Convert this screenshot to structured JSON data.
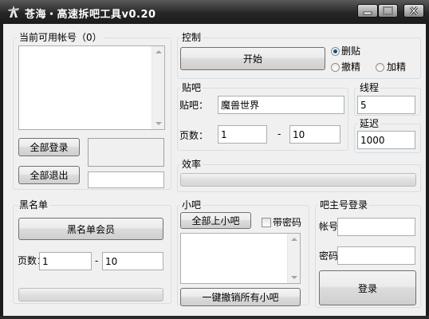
{
  "window": {
    "title": "苍海・高速拆吧工具v0.20",
    "controls": {
      "minimize": "minimize-icon",
      "maximize": "maximize-icon",
      "close": "close-icon"
    }
  },
  "accounts": {
    "group_label": "当前可用帐号（0）",
    "login_all_label": "全部登录",
    "logout_all_label": "全部退出"
  },
  "control": {
    "group_label": "控制",
    "start_label": "开始",
    "mode_delete_post": "删贴",
    "mode_remove_featured": "撤精",
    "mode_add_featured": "加精",
    "selected_mode": "删贴"
  },
  "tieba": {
    "group_label": "贴吧",
    "name_label": "贴吧：",
    "name_value": "魔兽世界",
    "pages_label": "页数：",
    "page_from": "1",
    "page_sep": "-",
    "page_to": "10"
  },
  "threads": {
    "group_label": "线程",
    "value": "5"
  },
  "delay": {
    "group_label": "延迟",
    "value": "1000"
  },
  "efficiency": {
    "group_label": "效率"
  },
  "blacklist": {
    "group_label": "黑名单",
    "members_label": "黑名单会员",
    "pages_label": "页数：",
    "page_from": "1",
    "page_sep": "-",
    "page_to": "10"
  },
  "small_bars": {
    "group_label": "小吧",
    "all_promote_label": "全部上小吧",
    "with_password_label": "带密码",
    "revoke_all_label": "一键撤销所有小吧"
  },
  "owner_login": {
    "group_label": "吧主号登录",
    "account_label": "帐号",
    "password_label": "密码",
    "login_label": "登录"
  }
}
